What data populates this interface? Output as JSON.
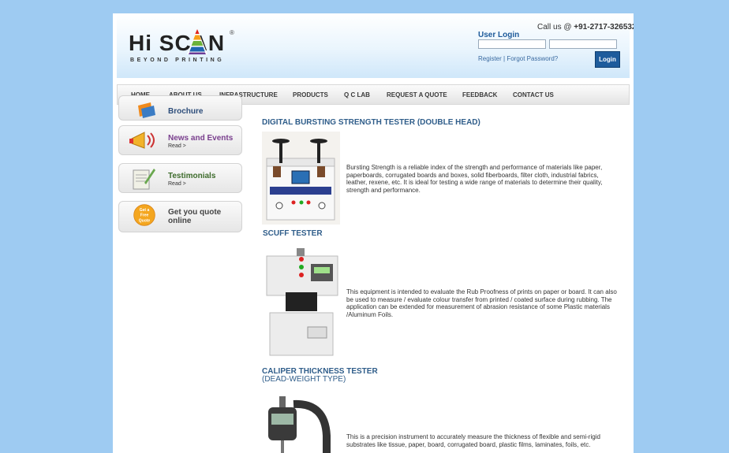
{
  "header": {
    "logo_text": "Hi SCAN",
    "logo_tagline": "BEYOND PRINTING",
    "logo_reg": "®",
    "callus_label": "Call us @",
    "phone": "+91-2717-326532",
    "user_login_label": "User Login",
    "register_link": "Register",
    "separator": " | ",
    "forgot_link": "Forgot Password?",
    "login_button": "Login"
  },
  "nav": {
    "items": [
      "HOME",
      "ABOUT US",
      "INFRASTRUCTURE",
      "PRODUCTS",
      "Q C LAB",
      "REQUEST A QUOTE",
      "FEEDBACK",
      "CONTACT US"
    ]
  },
  "sidebar": {
    "items": [
      {
        "title": "Brochure",
        "read": ""
      },
      {
        "title": "News and Events",
        "read": "Read >"
      },
      {
        "title": "Testimonials",
        "read": "Read >"
      },
      {
        "title": "Get you quote online",
        "read": ""
      }
    ],
    "quote_badge": "Get a Free Quote"
  },
  "products": [
    {
      "title": "DIGITAL BURSTING STRENGTH TESTER (DOUBLE HEAD)",
      "subtitle": "",
      "description": "Bursting Strength is a reliable index of the strength and performance of materials like paper, paperboards, corrugated boards and boxes, solid fiberboards, filter cloth, industrial fabrics, leather, rexene, etc. It is ideal for testing a wide range of materials to determine their quality, strength and performance."
    },
    {
      "title": "SCUFF TESTER",
      "subtitle": "",
      "description": "This equipment is intended to evaluate the Rub Proofness of prints on paper or board. It can also be used to measure / evaluate colour transfer from printed / coated surface during rubbing. The application can be extended for measurement of abrasion resistance of some Plastic materials /Aluminum Foils."
    },
    {
      "title": "CALIPER THICKNESS TESTER",
      "subtitle": "(DEAD-WEIGHT TYPE)",
      "description": "This is a precision instrument to accurately measure the thickness of flexible and semi-rigid substrates like tissue, paper, board, corrugated board, plastic films, laminates, foils, etc."
    }
  ],
  "colors": {
    "background": "#9ecbf2",
    "accent": "#1e5c9c",
    "title": "#2f5d8a"
  }
}
